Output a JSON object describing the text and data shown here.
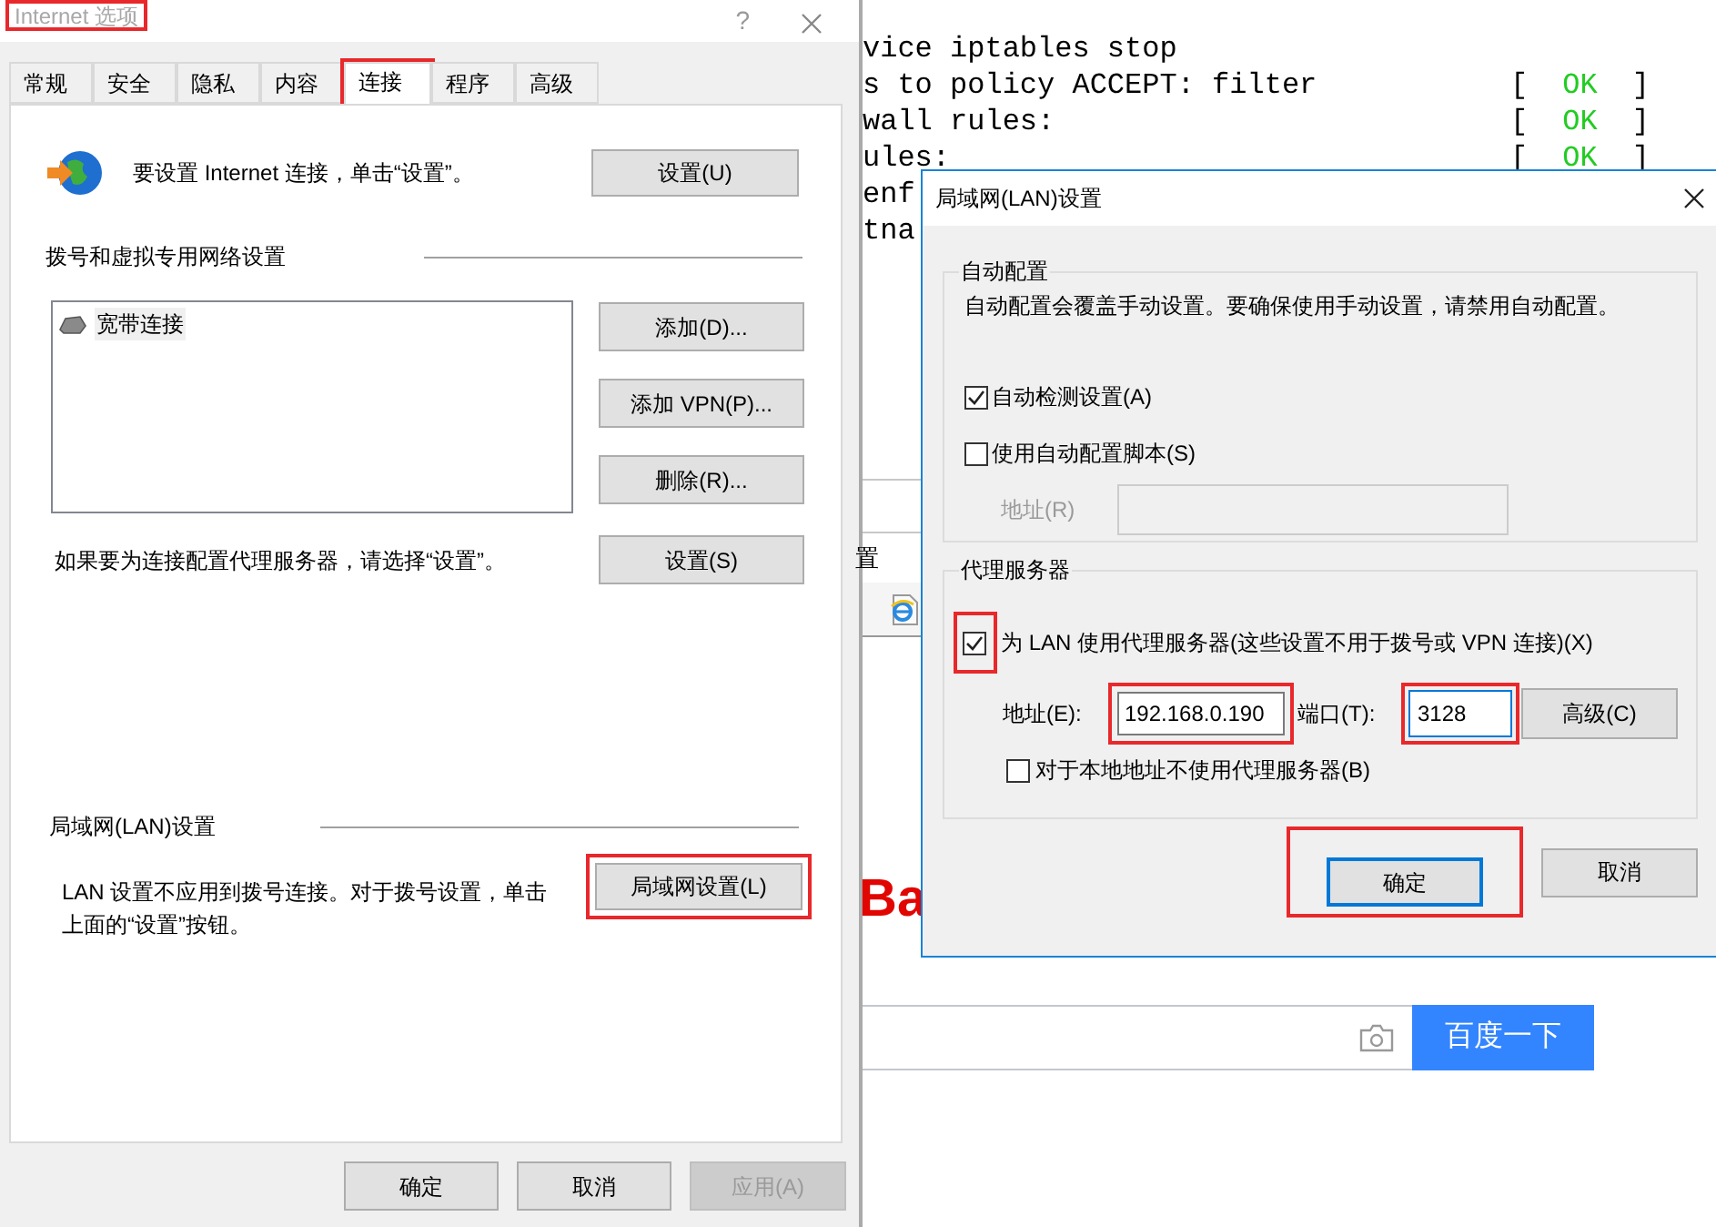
{
  "internet_options": {
    "title": "Internet 选项",
    "title_highlighted": true,
    "help": "?",
    "tabs": [
      {
        "label": "常规",
        "selected": false,
        "highlighted": false
      },
      {
        "label": "安全",
        "selected": false,
        "highlighted": false
      },
      {
        "label": "隐私",
        "selected": false,
        "highlighted": false
      },
      {
        "label": "内容",
        "selected": false,
        "highlighted": false
      },
      {
        "label": "连接",
        "selected": true,
        "highlighted": true
      },
      {
        "label": "程序",
        "selected": false,
        "highlighted": false
      },
      {
        "label": "高级",
        "selected": false,
        "highlighted": false
      }
    ],
    "setup": {
      "text": "要设置 Internet 连接，单击“设置”。",
      "button": "设置(U)"
    },
    "dialup": {
      "heading": "拨号和虚拟专用网络设置",
      "connections": [
        "宽带连接"
      ],
      "buttons": [
        "添加(D)...",
        "添加 VPN(P)...",
        "删除(R)..."
      ],
      "proxy_text": "如果要为连接配置代理服务器，请选择“设置”。",
      "proxy_button": "设置(S)"
    },
    "lan": {
      "heading": "局域网(LAN)设置",
      "text": "LAN 设置不应用到拨号连接。对于拨号设置，单击上面的“设置”按钮。",
      "button": "局域网设置(L)",
      "button_highlighted": true
    },
    "footer": [
      {
        "label": "确定",
        "disabled": false
      },
      {
        "label": "取消",
        "disabled": false
      },
      {
        "label": "应用(A)",
        "disabled": true
      }
    ]
  },
  "background": {
    "terminal": [
      {
        "text": "vice iptables stop"
      },
      {
        "text": "s to policy ACCEPT: filter",
        "status": {
          "open": "[",
          "word": "OK",
          "close": "]"
        }
      },
      {
        "text": "wall rules:",
        "status": {
          "open": "[",
          "word": "OK",
          "close": "]"
        }
      },
      {
        "text": "ules:",
        "status": {
          "open": "[",
          "word": "OK",
          "close": "]"
        }
      },
      {
        "text": "enf"
      },
      {
        "text": "tna"
      }
    ],
    "fragment": "置",
    "logo": "Ba",
    "search_button": "百度一下"
  },
  "lan_dialog": {
    "title": "局域网(LAN)设置",
    "auto": {
      "heading": "自动配置",
      "note": "自动配置会覆盖手动设置。要确保使用手动设置，请禁用自动配置。",
      "options": [
        {
          "label": "自动检测设置(A)",
          "checked": true
        },
        {
          "label": "使用自动配置脚本(S)",
          "checked": false
        }
      ],
      "script_address": {
        "label": "地址(R)",
        "disabled": true
      }
    },
    "proxy": {
      "heading": "代理服务器",
      "use_proxy": {
        "label": "为 LAN 使用代理服务器(这些设置不用于拨号或 VPN 连接)(X)",
        "checked": true,
        "highlighted": true
      },
      "address": {
        "label": "地址(E):",
        "value": "192.168.0.190",
        "highlighted": true
      },
      "port": {
        "label": "端口(T):",
        "value": "3128",
        "highlighted": true,
        "focused": true
      },
      "advanced": "高级(C)",
      "bypass": {
        "label": "对于本地地址不使用代理服务器(B)",
        "checked": false
      }
    },
    "buttons": [
      {
        "label": "确定",
        "default": true,
        "highlighted": true
      },
      {
        "label": "取消",
        "default": false,
        "highlighted": false
      }
    ]
  }
}
